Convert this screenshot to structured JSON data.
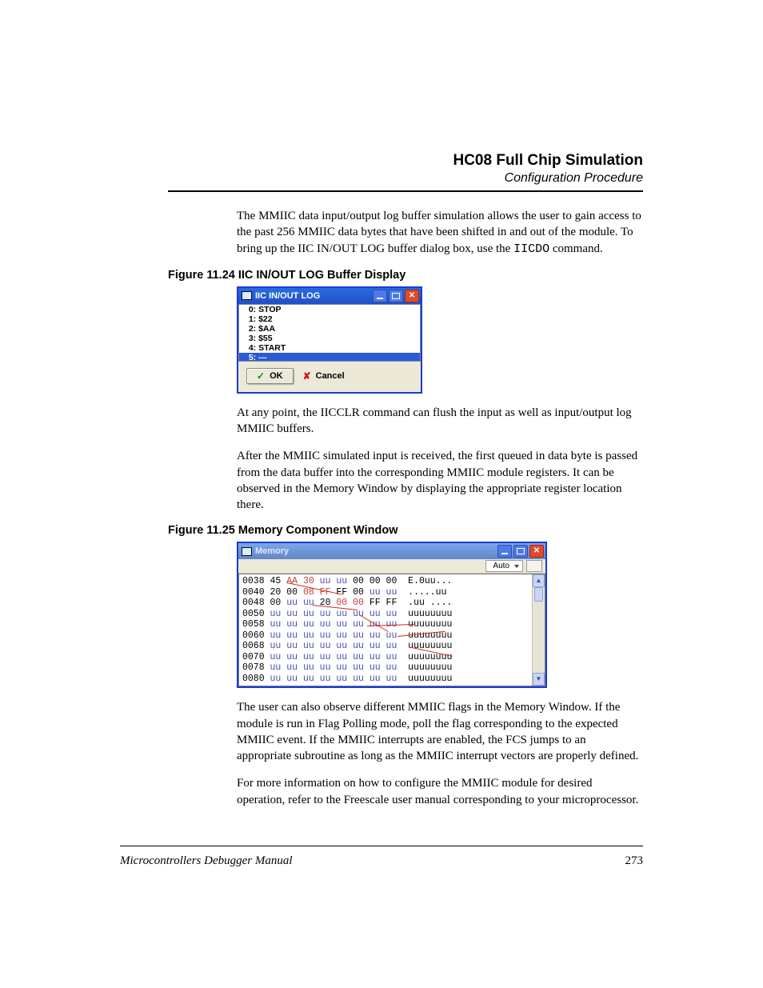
{
  "header": {
    "title": "HC08 Full Chip Simulation",
    "subtitle": "Configuration Procedure"
  },
  "para1_a": "The MMIIC data input/output log buffer simulation allows the user to gain access to the past 256 MMIIC data bytes that have been shifted in and out of the module. To bring up the IIC IN/OUT LOG buffer dialog box, use the ",
  "para1_code": "IICDO",
  "para1_b": " command.",
  "fig1_caption": "Figure 11.24  IIC IN/OUT LOG Buffer Display",
  "dialog1": {
    "title": "IIC IN/OUT LOG",
    "items": [
      "  0: STOP",
      "  1: $22",
      "  2: $AA",
      "  3: $55",
      "  4: START"
    ],
    "selected": "  5: ---",
    "ok": "OK",
    "cancel": "Cancel"
  },
  "para2": "At any point, the IICCLR command can flush the input as well as input/output log MMIIC buffers.",
  "para3": "After the MMIIC simulated input is received, the first queued in data byte is passed from the data buffer into the corresponding MMIIC module registers. It can be observed in the Memory Window by displaying the appropriate register location there.",
  "fig2_caption": "Figure 11.25  Memory Component Window",
  "dialog2": {
    "title": "Memory",
    "mode": "Auto",
    "rows": [
      {
        "addr": "0038",
        "bytes": [
          [
            "45",
            "b"
          ],
          [
            "AA",
            "bh"
          ],
          [
            "30",
            "bh"
          ],
          [
            "uu",
            "bu"
          ],
          [
            "uu",
            "bu"
          ],
          [
            "00",
            "b"
          ],
          [
            "00",
            "b"
          ],
          [
            "00",
            "b"
          ]
        ],
        "txt": "E.0uu..."
      },
      {
        "addr": "0040",
        "bytes": [
          [
            "20",
            "b"
          ],
          [
            "00",
            "b"
          ],
          [
            "08",
            "bh"
          ],
          [
            "FF",
            "bh"
          ],
          [
            "FF",
            "b"
          ],
          [
            "00",
            "b"
          ],
          [
            "uu",
            "bu"
          ],
          [
            "uu",
            "bu"
          ]
        ],
        "txt": ".....uu"
      },
      {
        "addr": "0048",
        "bytes": [
          [
            "00",
            "b"
          ],
          [
            "uu",
            "bu"
          ],
          [
            "uu",
            "bu"
          ],
          [
            "20",
            "b"
          ],
          [
            "00",
            "bh"
          ],
          [
            "00",
            "bh"
          ],
          [
            "FF",
            "b"
          ],
          [
            "FF",
            "b"
          ]
        ],
        "txt": ".uu ...."
      },
      {
        "addr": "0050",
        "bytes": [
          [
            "uu",
            "bu"
          ],
          [
            "uu",
            "bu"
          ],
          [
            "uu",
            "bu"
          ],
          [
            "uu",
            "bu"
          ],
          [
            "uu",
            "bu"
          ],
          [
            "uu",
            "bu"
          ],
          [
            "uu",
            "bu"
          ],
          [
            "uu",
            "bu"
          ]
        ],
        "txt": "uuuuuuuu"
      },
      {
        "addr": "0058",
        "bytes": [
          [
            "uu",
            "bu"
          ],
          [
            "uu",
            "bu"
          ],
          [
            "uu",
            "bu"
          ],
          [
            "uu",
            "bu"
          ],
          [
            "uu",
            "bu"
          ],
          [
            "uu",
            "bu"
          ],
          [
            "uu",
            "bu"
          ],
          [
            "uu",
            "bu"
          ]
        ],
        "txt": "uuuuuuuu"
      },
      {
        "addr": "0060",
        "bytes": [
          [
            "uu",
            "bu"
          ],
          [
            "uu",
            "bu"
          ],
          [
            "uu",
            "bu"
          ],
          [
            "uu",
            "bu"
          ],
          [
            "uu",
            "bu"
          ],
          [
            "uu",
            "bu"
          ],
          [
            "uu",
            "bu"
          ],
          [
            "uu",
            "bu"
          ]
        ],
        "txt": "uuuuuuuu"
      },
      {
        "addr": "0068",
        "bytes": [
          [
            "uu",
            "bu"
          ],
          [
            "uu",
            "bu"
          ],
          [
            "uu",
            "bu"
          ],
          [
            "uu",
            "bu"
          ],
          [
            "uu",
            "bu"
          ],
          [
            "uu",
            "bu"
          ],
          [
            "uu",
            "bu"
          ],
          [
            "uu",
            "bu"
          ]
        ],
        "txt": "uuuuuuuu"
      },
      {
        "addr": "0070",
        "bytes": [
          [
            "uu",
            "bu"
          ],
          [
            "uu",
            "bu"
          ],
          [
            "uu",
            "bu"
          ],
          [
            "uu",
            "bu"
          ],
          [
            "uu",
            "bu"
          ],
          [
            "uu",
            "bu"
          ],
          [
            "uu",
            "bu"
          ],
          [
            "uu",
            "bu"
          ]
        ],
        "txt": "uuuuuuuu"
      },
      {
        "addr": "0078",
        "bytes": [
          [
            "uu",
            "bu"
          ],
          [
            "uu",
            "bu"
          ],
          [
            "uu",
            "bu"
          ],
          [
            "uu",
            "bu"
          ],
          [
            "uu",
            "bu"
          ],
          [
            "uu",
            "bu"
          ],
          [
            "uu",
            "bu"
          ],
          [
            "uu",
            "bu"
          ]
        ],
        "txt": "uuuuuuuu"
      },
      {
        "addr": "0080",
        "bytes": [
          [
            "uu",
            "bu"
          ],
          [
            "uu",
            "bu"
          ],
          [
            "uu",
            "bu"
          ],
          [
            "uu",
            "bu"
          ],
          [
            "uu",
            "bu"
          ],
          [
            "uu",
            "bu"
          ],
          [
            "uu",
            "bu"
          ],
          [
            "uu",
            "bu"
          ]
        ],
        "txt": "uuuuuuuu"
      }
    ]
  },
  "para4": "The user can also observe different MMIIC flags in the Memory Window. If the module is run in Flag Polling mode, poll the flag corresponding to the expected MMIIC event. If the MMIIC interrupts are enabled, the FCS jumps to an appropriate subroutine as long as the MMIIC interrupt vectors are properly defined.",
  "para5": "For more information on how to configure the MMIIC module for desired operation, refer to the Freescale user manual corresponding to your microprocessor.",
  "footer": {
    "left": "Microcontrollers Debugger Manual",
    "page": "273"
  }
}
